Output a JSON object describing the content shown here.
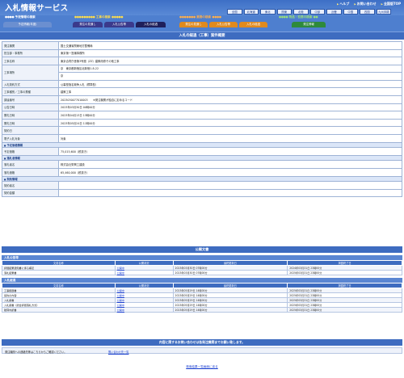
{
  "header": {
    "app_title": "入札情報サービス",
    "top_links": [
      "ヘルプ",
      "お問い合わせ",
      "全国版TOP"
    ],
    "regions": [
      "全国",
      "北海道",
      "東北",
      "関東",
      "北陸",
      "中部",
      "近畿",
      "中国",
      "四国",
      "九州沖縄"
    ],
    "nav_groups": [
      {
        "caption": "予定情報の検索",
        "color": "#ffffff",
        "tabs": [
          {
            "label": "予定情報(年度)",
            "color": "#6b8fd0"
          }
        ]
      },
      {
        "caption": "工事の検索",
        "color": "#ffde4d",
        "tabs": [
          {
            "label": "発注の見通し",
            "color": "#3b3a8c"
          },
          {
            "label": "入札公告等",
            "color": "#3b3a8c"
          },
          {
            "label": "入札の経過",
            "color": "#1f1f5a"
          }
        ]
      },
      {
        "caption": "業務の検索",
        "color": "#ffb04d",
        "tabs": [
          {
            "label": "発注の見通し",
            "color": "#e08a1e"
          },
          {
            "label": "入札公告等",
            "color": "#e08a1e"
          },
          {
            "label": "入札の経過",
            "color": "#e08a1e"
          }
        ]
      },
      {
        "caption": "物品・役務の検索",
        "color": "#9ae07a",
        "tabs": [
          {
            "label": "発注情報",
            "color": "#2e8a3b"
          }
        ]
      }
    ]
  },
  "page_title": "入札の経過（工事）案件概要",
  "detail_rows": [
    {
      "type": "row",
      "label": "発注機関",
      "value": "国土交通省関東地方整備局"
    },
    {
      "type": "row",
      "label": "担当部・事務所",
      "value": "東京第一営繕事務所"
    },
    {
      "type": "row",
      "label": "工事名称",
      "value": "東京合同庁舎第3号館（ZZ）建築改修その他工事"
    },
    {
      "type": "row2",
      "label": "工事場所",
      "value": "京　東京都新宿区北新宿1-8-22",
      "value2": "京"
    },
    {
      "type": "row",
      "label": "入札契約方式",
      "value": "公募型指名競争入札（標準型）"
    },
    {
      "type": "row",
      "label": "工事種別／工事の業種",
      "value": "建築工事"
    },
    {
      "type": "row",
      "label": "調達番号",
      "value": "2023030077010003　　※発注機関が独自に定めるコード"
    },
    {
      "type": "row",
      "label": "公告日時",
      "value": "2023年03月30日 00時00分"
    },
    {
      "type": "row",
      "label": "開札日時",
      "value": "2023年04月13日 15時00分"
    },
    {
      "type": "row",
      "label": "開札日時",
      "value": "2023年05月24日 11時00分"
    },
    {
      "type": "row",
      "label": "契約日",
      "value": ""
    },
    {
      "type": "row",
      "label": "電子入札対象",
      "value": "対象"
    },
    {
      "type": "section",
      "label": "予定価格情報"
    },
    {
      "type": "row",
      "label": "予定価格",
      "value": "75,015,600（税抜き）"
    },
    {
      "type": "section",
      "label": "落札者情報"
    },
    {
      "type": "row",
      "label": "落札者名",
      "value": "株式会社栄興工建設"
    },
    {
      "type": "row",
      "label": "落札価格",
      "value": "65,460,000（税抜き）"
    },
    {
      "type": "section",
      "label": "契約情報"
    },
    {
      "type": "row",
      "label": "契約者名",
      "value": ""
    },
    {
      "type": "row",
      "label": "契約金額",
      "value": ""
    }
  ],
  "documents": {
    "title": "公開文書",
    "groups": [
      {
        "title": "入札公告等",
        "headers": [
          "文書名称",
          "公開状況",
          "最終更新日",
          "掲載終了日"
        ],
        "rows": [
          [
            "評価結果通知書に係る補足",
            "公開中",
            "2023年03月30日 07時00分",
            "2024年03月31日 23時00分"
          ],
          [
            "落札結果書",
            "公開中",
            "2023年03月30日 07時00分",
            "2025年03月31日 23時00分"
          ]
        ]
      },
      {
        "title": "入札経過",
        "headers": [
          "文書名称",
          "公開状況",
          "最終更新日",
          "掲載終了日"
        ],
        "rows": [
          [
            "工事経歴書",
            "公開中",
            "2023年05月29日 14時00分",
            "2025年03月31日 23時00分"
          ],
          [
            "契約の内容",
            "公開中",
            "2023年05月29日 14時00分",
            "2025年03月31日 23時00分"
          ],
          [
            "入札調書",
            "公開中",
            "2023年05月29日 14時00分",
            "2025年03月31日 23時00分"
          ],
          [
            "入札調書（総合評価落札方式）",
            "公開中",
            "2023年05月29日 14時00分",
            "2025年03月31日 23時00分"
          ],
          [
            "積算内訳書",
            "公開中",
            "2023年05月29日 14時00分",
            "2025年03月31日 23時00分"
          ]
        ]
      }
    ]
  },
  "footer": {
    "inquiry_bar": "内容に関するお問い合わせは各発注機関までお願い致します。",
    "contact_text": "発注機関への連絡先等はこちらからご確認ください。",
    "contact_link": "問い合わせ先一覧",
    "back_link": "検索結果一覧画面に戻る"
  }
}
